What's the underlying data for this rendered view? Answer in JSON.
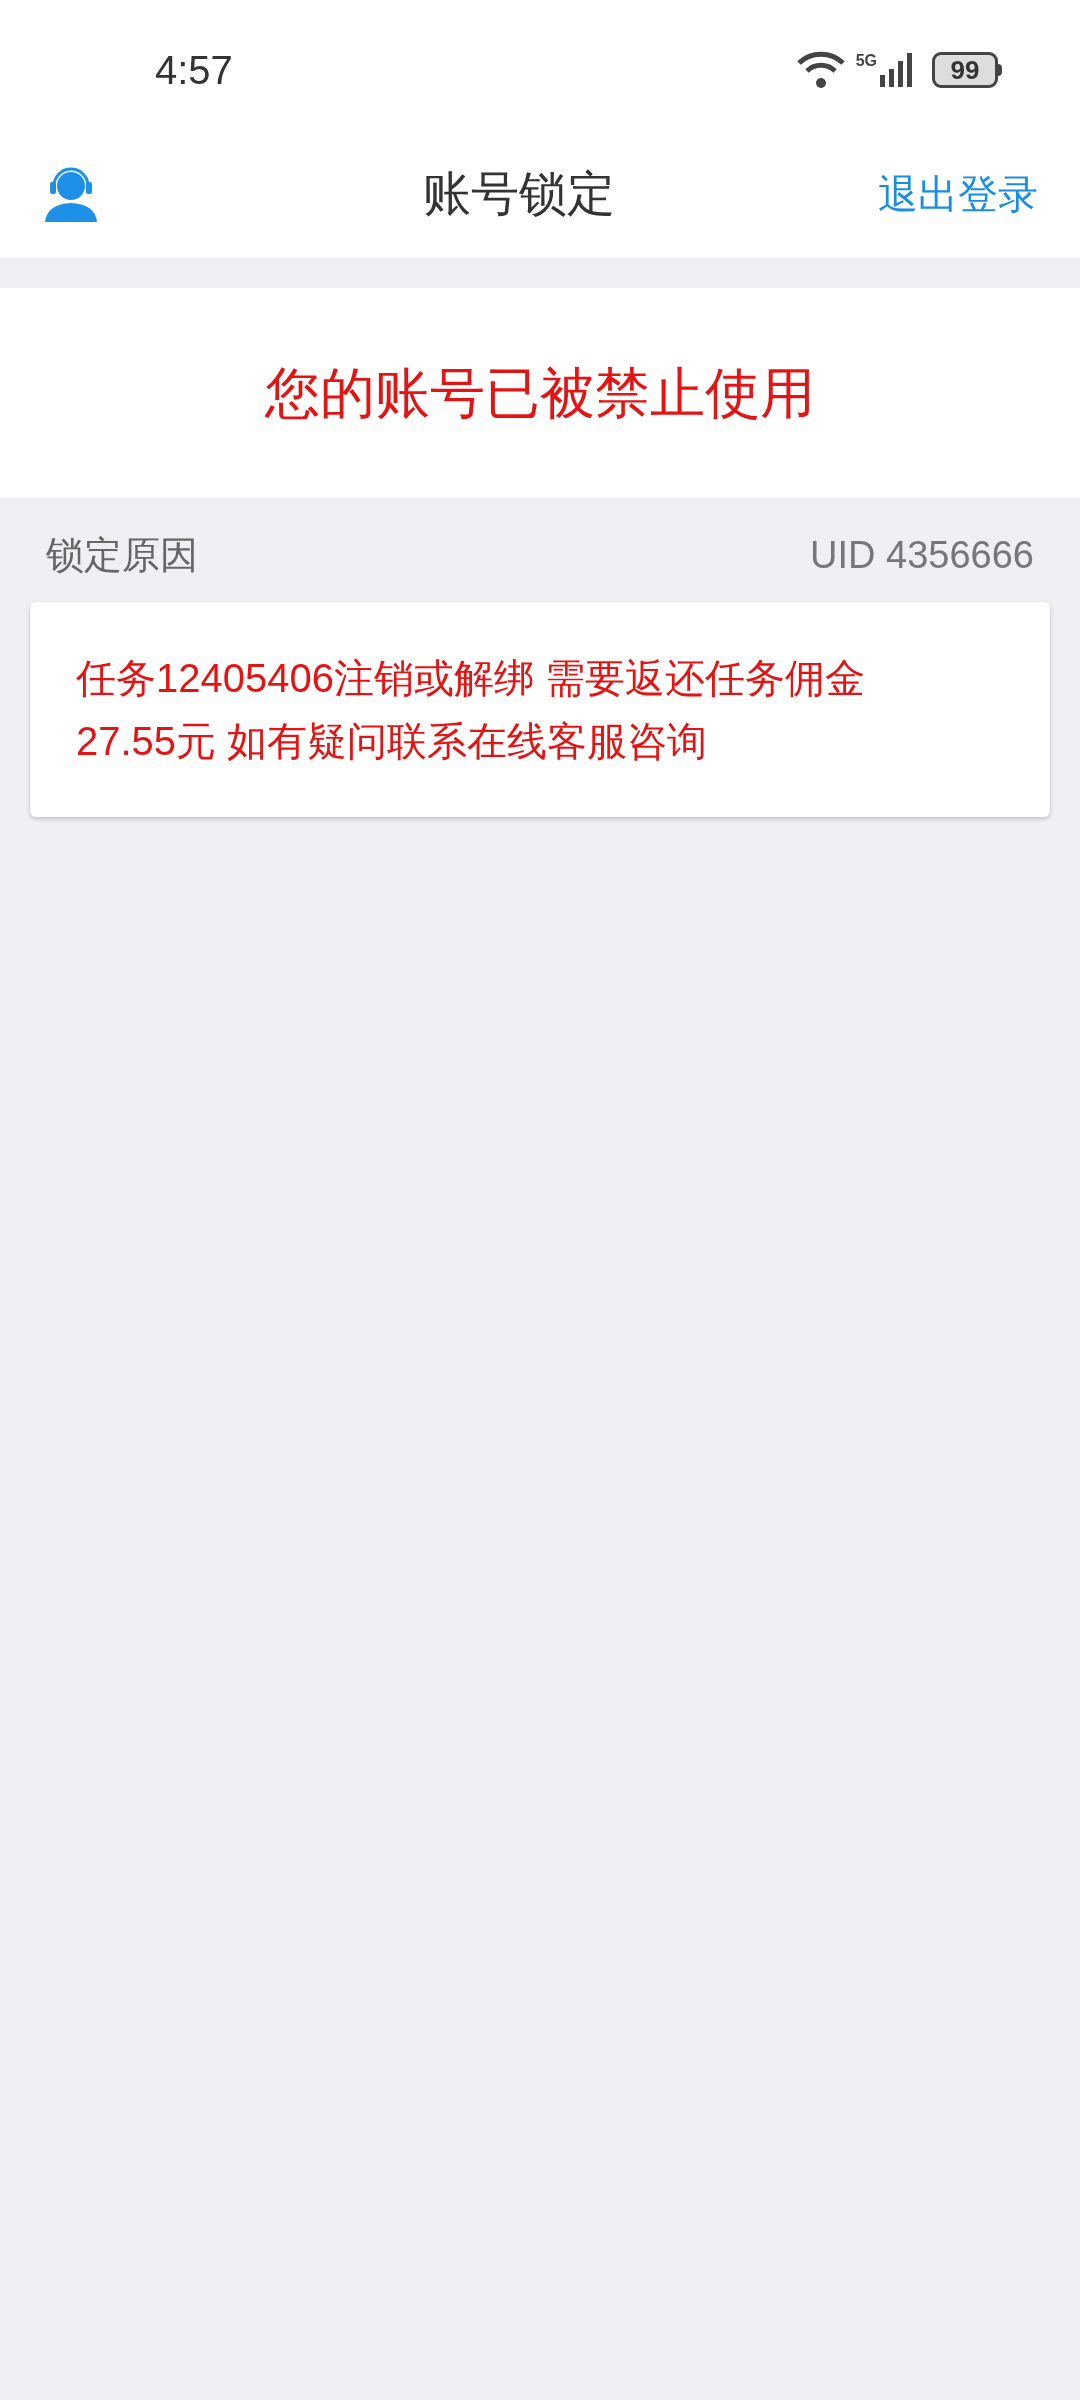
{
  "status_bar": {
    "time": "4:57",
    "network": "5G",
    "battery": "99"
  },
  "header": {
    "title": "账号锁定",
    "action": "退出登录"
  },
  "banner": {
    "message": "您的账号已被禁止使用"
  },
  "section": {
    "label": "锁定原因",
    "uid": "UID 4356666"
  },
  "reason_card": {
    "text": "任务12405406注销或解绑 需要返还任务佣金 27.55元 如有疑问联系在线客服咨询"
  }
}
